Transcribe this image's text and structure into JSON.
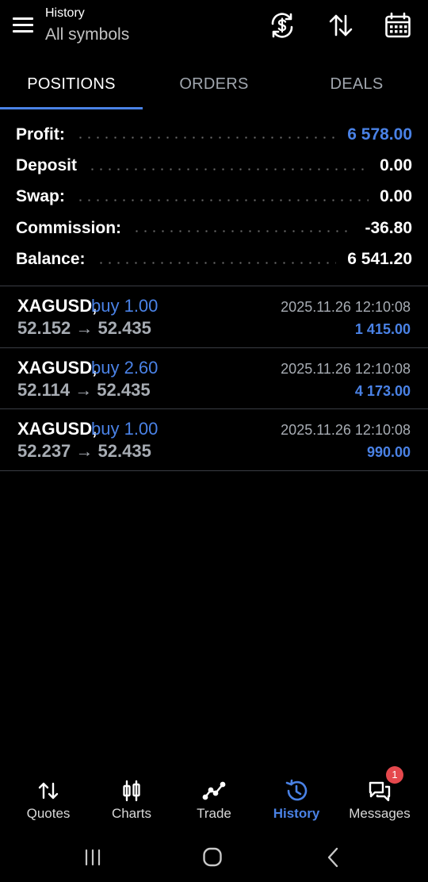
{
  "header": {
    "title": "History",
    "subtitle": "All symbols",
    "icons": [
      "menu-icon",
      "currency-exchange-icon",
      "sort-icon",
      "calendar-icon"
    ]
  },
  "tabs": [
    {
      "label": "POSITIONS",
      "active": true
    },
    {
      "label": "ORDERS",
      "active": false
    },
    {
      "label": "DEALS",
      "active": false
    }
  ],
  "summary": [
    {
      "label": "Profit:",
      "value": "6 578.00",
      "highlight": true
    },
    {
      "label": "Deposit",
      "value": "0.00",
      "highlight": false
    },
    {
      "label": "Swap:",
      "value": "0.00",
      "highlight": false
    },
    {
      "label": "Commission:",
      "value": "-36.80",
      "highlight": false
    },
    {
      "label": "Balance:",
      "value": "6 541.20",
      "highlight": false
    }
  ],
  "positions": [
    {
      "symbol": "XAGUSD,",
      "side": "buy 1.00",
      "prices": "52.152 → 52.435",
      "time": "2025.11.26 12:10:08",
      "profit": "1 415.00"
    },
    {
      "symbol": "XAGUSD,",
      "side": "buy 2.60",
      "prices": "52.114 → 52.435",
      "time": "2025.11.26 12:10:08",
      "profit": "4 173.00"
    },
    {
      "symbol": "XAGUSD,",
      "side": "buy 1.00",
      "prices": "52.237 → 52.435",
      "time": "2025.11.26 12:10:08",
      "profit": "990.00"
    }
  ],
  "bottom_nav": [
    {
      "label": "Quotes",
      "icon": "quotes-icon",
      "active": false
    },
    {
      "label": "Charts",
      "icon": "candlestick-icon",
      "active": false
    },
    {
      "label": "Trade",
      "icon": "trade-line-icon",
      "active": false
    },
    {
      "label": "History",
      "icon": "history-icon",
      "active": true
    },
    {
      "label": "Messages",
      "icon": "chat-icon",
      "active": false,
      "badge": "1"
    }
  ],
  "system_nav": [
    "recent-apps-icon",
    "home-icon",
    "back-icon"
  ],
  "colors": {
    "accent": "#4a82e6",
    "background": "#000000",
    "muted": "#a7acb3",
    "badge": "#e5484d"
  }
}
